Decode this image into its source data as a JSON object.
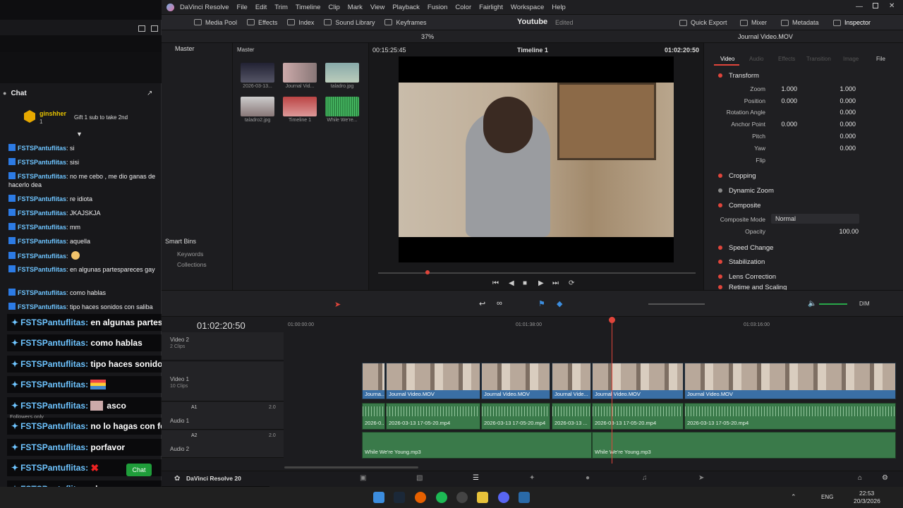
{
  "chat": {
    "title": "Chat",
    "gift": {
      "user": "ginshher",
      "count": "1",
      "text": "Gift 1 sub to take 2nd"
    },
    "messages": [
      {
        "user": "FSTSPantuflitas",
        "text": ": si"
      },
      {
        "user": "FSTSPantuflitas",
        "text": ": sisi"
      },
      {
        "user": "FSTSPantuflitas",
        "text": ": no me cebo , me dio ganas de hacerlo dea"
      },
      {
        "user": "FSTSPantuflitas",
        "text": ": re idiota"
      },
      {
        "user": "FSTSPantuflitas",
        "text": ": JKAJSKJA"
      },
      {
        "user": "FSTSPantuflitas",
        "text": ": mm"
      },
      {
        "user": "FSTSPantuflitas",
        "text": ": aquella"
      },
      {
        "user": "FSTSPantuflitas",
        "text": ":"
      },
      {
        "user": "FSTSPantuflitas",
        "text": ": en algunas partespareces gay"
      },
      {
        "user": "FSTSPantuflitas",
        "text": ": como hablas"
      },
      {
        "user": "FSTSPantuflitas",
        "text": ": tipo haces sonidos con saliba"
      }
    ],
    "followers_only": "Followers only",
    "chat_button": "Chat"
  },
  "overlay": {
    "messages": [
      {
        "user": "FSTSPantuflitas:",
        "text": "en algunas partespareces gay"
      },
      {
        "user": "FSTSPantuflitas:",
        "text": "como hablas"
      },
      {
        "user": "FSTSPantuflitas:",
        "text": "tipo haces sonidos con saliba"
      },
      {
        "user": "FSTSPantuflitas:",
        "text": ""
      },
      {
        "user": "FSTSPantuflitas:",
        "text": "asco"
      },
      {
        "user": "FSTSPantuflitas:",
        "text": "no lo hagas con feli"
      },
      {
        "user": "FSTSPantuflitas:",
        "text": "porfavor"
      },
      {
        "user": "FSTSPantuflitas:",
        "text": ""
      },
      {
        "user": "FSTSPantuflitas:",
        "text": "claro"
      }
    ]
  },
  "resolve": {
    "app_name": "DaVinci Resolve",
    "menu": [
      "File",
      "Edit",
      "Trim",
      "Timeline",
      "Clip",
      "Mark",
      "View",
      "Playback",
      "Fusion",
      "Color",
      "Fairlight",
      "Workspace",
      "Help"
    ],
    "toolbar_left": [
      "Media Pool",
      "Effects",
      "Index",
      "Sound Library",
      "Keyframes"
    ],
    "project_name": "Youtube",
    "project_status": "Edited",
    "toolbar_right": [
      "Quick Export",
      "Mixer",
      "Metadata",
      "Inspector"
    ],
    "zoom": "37%",
    "source_timecode": "00:15:25:45",
    "timeline_name": "Timeline 1",
    "record_timecode": "01:02:20:50",
    "inspector_clip": "Journal Video.MOV",
    "bins": {
      "master": "Master",
      "smart_bins": "Smart Bins",
      "keywords": "Keywords",
      "collections": "Collections"
    },
    "pool": {
      "header": "Master",
      "clips": [
        "2026-03-13...",
        "Journal Vid...",
        "taladro.jpg",
        "taladro2.jpg",
        "Timeline 1",
        "While We're..."
      ]
    },
    "inspector": {
      "tabs": [
        "Video",
        "Audio",
        "Effects",
        "Transition",
        "Image",
        "File"
      ],
      "transform": "Transform",
      "rows": [
        {
          "label": "Zoom",
          "x": "1.000",
          "y": "1.000"
        },
        {
          "label": "Position",
          "x": "0.000",
          "y": "0.000"
        },
        {
          "label": "Rotation Angle",
          "v": "0.000"
        },
        {
          "label": "Anchor Point",
          "x": "0.000",
          "y": "0.000"
        },
        {
          "label": "Pitch",
          "v": "0.000"
        },
        {
          "label": "Yaw",
          "v": "0.000"
        },
        {
          "label": "Flip"
        }
      ],
      "sections": [
        "Cropping",
        "Dynamic Zoom",
        "Composite",
        "Speed Change",
        "Stabilization",
        "Lens Correction",
        "Retime and Scaling"
      ],
      "composite_mode_label": "Composite Mode",
      "composite_mode": "Normal",
      "opacity_label": "Opacity",
      "opacity": "100.00"
    },
    "timeline": {
      "timecode": "01:02:20:50",
      "ruler": [
        "01:00:00:00",
        "01:01:38:00",
        "01:03:16:00"
      ],
      "tracks": [
        {
          "name": "Video 2",
          "count": "2 Clips"
        },
        {
          "name": "Video 1",
          "count": "10 Clips"
        },
        {
          "name": "Audio 1",
          "tag": "A1",
          "level": "2.0"
        },
        {
          "name": "Audio 2",
          "tag": "A2",
          "level": "2.0"
        }
      ],
      "video_clips": [
        "Journa...",
        "Journal Video.MOV",
        "Journal Video.MOV",
        "Journal Vide...",
        "Journal Video.MOV",
        "Journal Video.MOV"
      ],
      "audio_clips": [
        "2026-0...",
        "2026-03-13 17-05-20.mp4",
        "2026-03-13 17-05-20.mp4",
        "2026-03-13 ...",
        "2026-03-13 17-05-20.mp4",
        "2026-03-13 17-05-20.mp4"
      ],
      "music_clips": [
        "While We're Young.mp3",
        "While We're Young.mp3"
      ],
      "dim": "DIM"
    },
    "footer": "DaVinci Resolve 20"
  },
  "taskbar": {
    "lang": "ENG",
    "time": "22:53",
    "date": "20/3/2026"
  }
}
